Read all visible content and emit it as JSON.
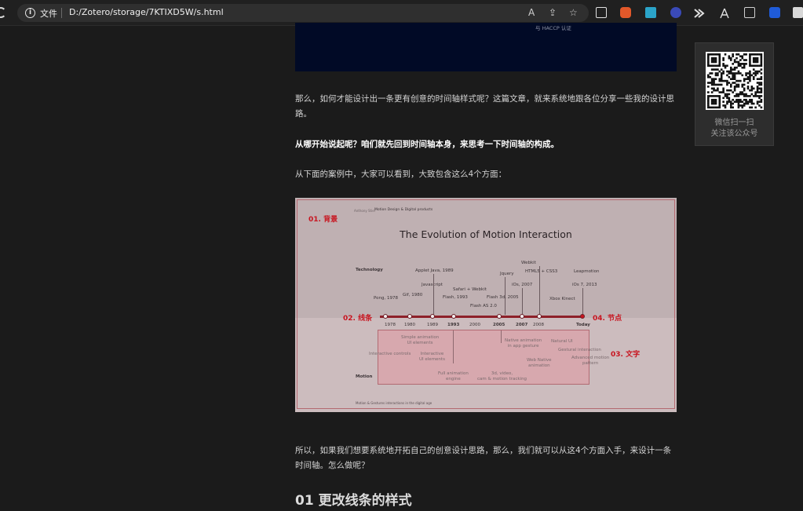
{
  "browser": {
    "site_label": "文件",
    "url": "D:/Zotero/storage/7KTIXD5W/s.html",
    "info_icon": "i",
    "read_aloud_glyph": "A",
    "share_glyph": "⇪",
    "favorite_glyph": "☆"
  },
  "hero": {
    "caption": "与 HACCP 认证"
  },
  "article": {
    "para1": "那么，如何才能设计出一条更有创意的时间轴样式呢？这篇文章，就来系统地跟各位分享一些我的设计思路。",
    "para2": "从哪开始说起呢？咱们就先回到时间轴本身，来思考一下时间轴的构成。",
    "para3": "从下面的案例中，大家可以看到，大致包含这么4个方面：",
    "para4": "所以，如果我们想要系统地开拓自己的创意设计思路，那么，我们就可以从这4个方面入手，来设计一条时间轴。怎么做呢？",
    "heading": "01 更改线条的样式"
  },
  "figure": {
    "header_author": "Anthony Stier",
    "header_title": "Motion Design & Digital products",
    "title": "The Evolution of Motion Interaction",
    "technology_label": "Technology",
    "motion_label": "Motion",
    "footer": "Motion & Gestures interactions in the digital age",
    "callouts": {
      "background": "01. 背景",
      "line": "02. 线条",
      "text": "03. 文字",
      "node": "04. 节点"
    },
    "years": [
      "1978",
      "1980",
      "1989",
      "1993",
      "2000",
      "2005",
      "2007",
      "2008",
      "Today"
    ],
    "tech_labels": {
      "pong": "Pong, 1978",
      "gif": "Gif, 1980",
      "applet": "Applet Java, 1989",
      "javascript": "Javascript",
      "safari": "Safari + Webkit",
      "flash1993": "Flash, 1993",
      "flashas": "Flash AS 2.0",
      "jquery": "Jquery",
      "flash3d": "Flash 3d, 2005",
      "ios": "iOs, 2007",
      "webkit": "Webkit",
      "html5": "HTML5 + CSS3",
      "xbox": "Xbox Kinect",
      "leapmotion": "Leapmotion",
      "ios7": "iOs 7, 2013"
    },
    "motion_labels": {
      "simple": "Simple animation\nUI elements",
      "interactive_controls": "Interactive controls",
      "interactive_ui": "Interactive\nUI elements",
      "full_anim": "Full animation\nengine",
      "native": "Native animation\nin app gesture",
      "video3d": "3d, video,\ncam & motion tracking",
      "webnative": "Web Native\nanimation",
      "natural": "Natural UI",
      "gestural": "Gestural interaction",
      "advanced": "Advanced motion\npattern"
    }
  },
  "qr": {
    "line1": "微信扫一扫",
    "line2": "关注该公众号"
  }
}
